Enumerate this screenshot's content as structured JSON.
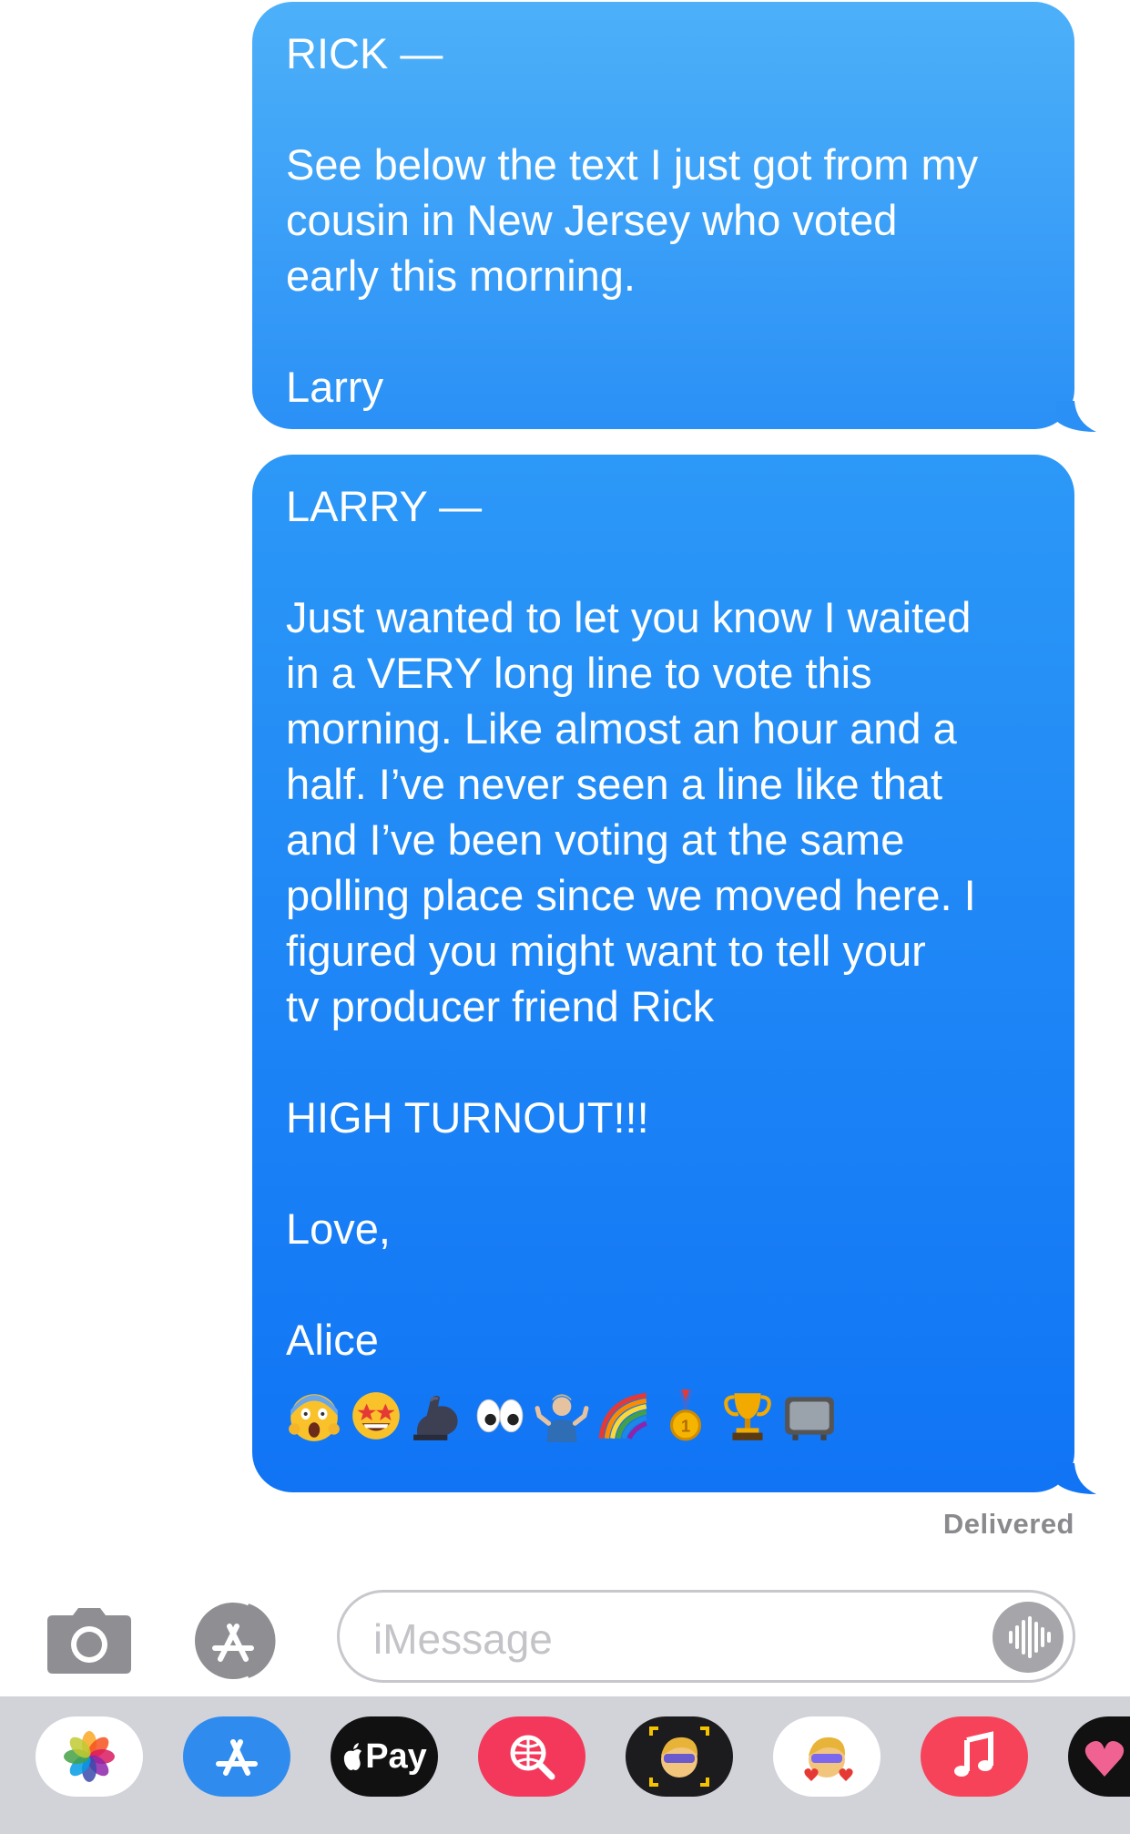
{
  "conversation": {
    "messages": [
      {
        "sender": "me",
        "lines": [
          "RICK —",
          "",
          "See below the text I just got from my",
          "cousin in New Jersey who voted",
          "early this morning.",
          "",
          "Larry"
        ]
      },
      {
        "sender": "me",
        "lines": [
          "LARRY —",
          "",
          "Just wanted to let you know I waited",
          "in a VERY long line to vote this",
          "morning. Like almost an hour and a",
          "half. I’ve never seen a line like that",
          "and I’ve been voting at the same",
          "polling place since we moved here. I",
          "figured you might want to tell your",
          "tv producer friend Rick",
          "",
          "HIGH TURNOUT!!!",
          "",
          "Love,",
          "",
          "Alice"
        ],
        "emojis": [
          "face-screaming-icon",
          "star-struck-icon",
          "flexed-biceps-icon",
          "eyes-icon",
          "shrugging-person-icon",
          "rainbow-icon",
          "gold-medal-icon",
          "trophy-icon",
          "television-icon"
        ]
      }
    ],
    "status": "Delivered"
  },
  "input_bar": {
    "placeholder": "iMessage"
  },
  "app_drawer": {
    "apps": [
      {
        "name": "photos"
      },
      {
        "name": "app-store"
      },
      {
        "name": "apple-pay",
        "label": "Pay"
      },
      {
        "name": "images-search"
      },
      {
        "name": "memoji"
      },
      {
        "name": "memoji-stickers"
      },
      {
        "name": "music"
      },
      {
        "name": "extra-app"
      }
    ]
  },
  "colors": {
    "bubble_top": "#4db0f9",
    "bubble_bottom": "#1074f5",
    "status_gray": "#8a8a8e"
  }
}
